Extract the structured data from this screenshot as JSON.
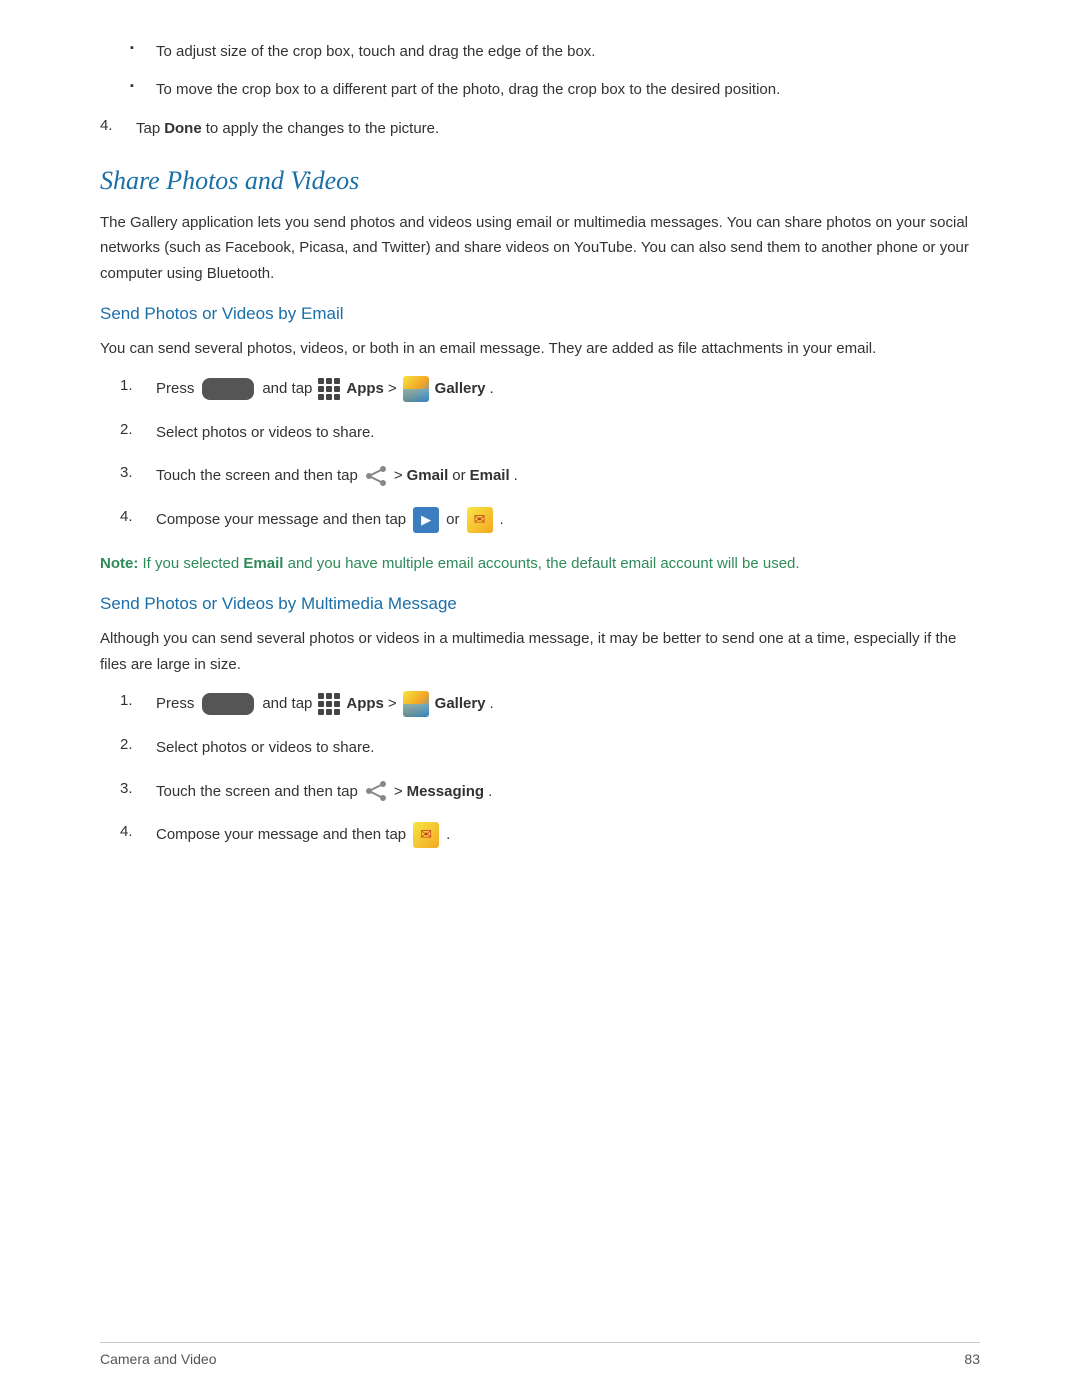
{
  "page": {
    "footer_left": "Camera and Video",
    "footer_right": "83",
    "bullets": [
      "To adjust size of the crop box, touch and drag the edge of the box.",
      "To move the crop box to a different part of the photo, drag the crop box to the desired position."
    ],
    "step4_text": "Tap ",
    "step4_bold": "Done",
    "step4_rest": " to apply the changes to the picture.",
    "section_title": "Share Photos and Videos",
    "intro_text": "The Gallery application lets you send photos and videos using email or multimedia messages. You can share photos on your social networks (such as Facebook, Picasa, and Twitter) and share videos on YouTube. You can also send them to another phone or your computer using Bluetooth.",
    "email_section": {
      "title": "Send Photos or Videos by Email",
      "intro": "You can send several photos, videos, or both in an email message. They are added as file attachments in your email.",
      "steps": [
        {
          "num": "1.",
          "pre": "Press",
          "mid": "and tap",
          "apps_label": "Apps",
          "gt": ">",
          "gallery_label": "Gallery",
          "bold_gallery": true
        },
        {
          "num": "2.",
          "text": "Select photos or videos to share."
        },
        {
          "num": "3.",
          "pre": "Touch the screen and then tap",
          "gt": ">",
          "bold1": "Gmail",
          "or": "or",
          "bold2": "Email",
          "period": "."
        },
        {
          "num": "4.",
          "pre": "Compose your message and then tap",
          "or": "or",
          "period": "."
        }
      ],
      "note": "Note: If you selected Email and you have multiple email accounts, the default email account will be used."
    },
    "mms_section": {
      "title": "Send Photos or Videos by Multimedia Message",
      "intro": "Although you can send several photos or videos in a multimedia message, it may be better to send one at a time, especially if the files are large in size.",
      "steps": [
        {
          "num": "1.",
          "pre": "Press",
          "mid": "and tap",
          "apps_label": "Apps",
          "gt": ">",
          "gallery_label": "Gallery",
          "bold_gallery": true
        },
        {
          "num": "2.",
          "text": "Select photos or videos to share."
        },
        {
          "num": "3.",
          "pre": "Touch the screen and then tap",
          "gt": ">",
          "bold1": "Messaging",
          "period": "."
        },
        {
          "num": "4.",
          "pre": "Compose your message and then tap",
          "period": "."
        }
      ]
    }
  }
}
